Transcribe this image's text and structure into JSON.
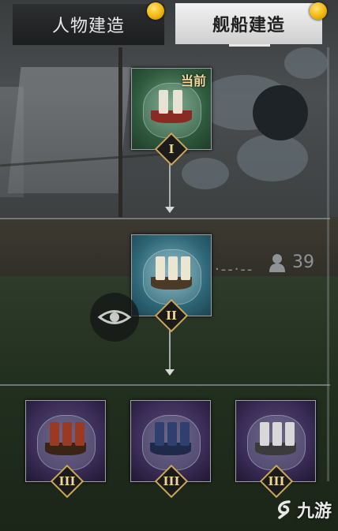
{
  "tabs": [
    {
      "label": "人物建造",
      "active": false
    },
    {
      "label": "舰船建造",
      "active": true
    }
  ],
  "tree": {
    "tier1": {
      "numeral": "I",
      "badge": "当前",
      "theme": "green"
    },
    "tier2": {
      "numeral": "II",
      "theme": "blue"
    },
    "tier3": [
      {
        "numeral": "III",
        "theme": "purple-red"
      },
      {
        "numeral": "III",
        "theme": "purple-blue"
      },
      {
        "numeral": "III",
        "theme": "purple-white"
      }
    ]
  },
  "hud": {
    "population": "39"
  },
  "watermark": {
    "brand": "九游"
  },
  "colors": {
    "accent_gold": "#f0b200",
    "tier_border": "#c9a65a",
    "active_tab_bg": "#e6e6e6"
  }
}
